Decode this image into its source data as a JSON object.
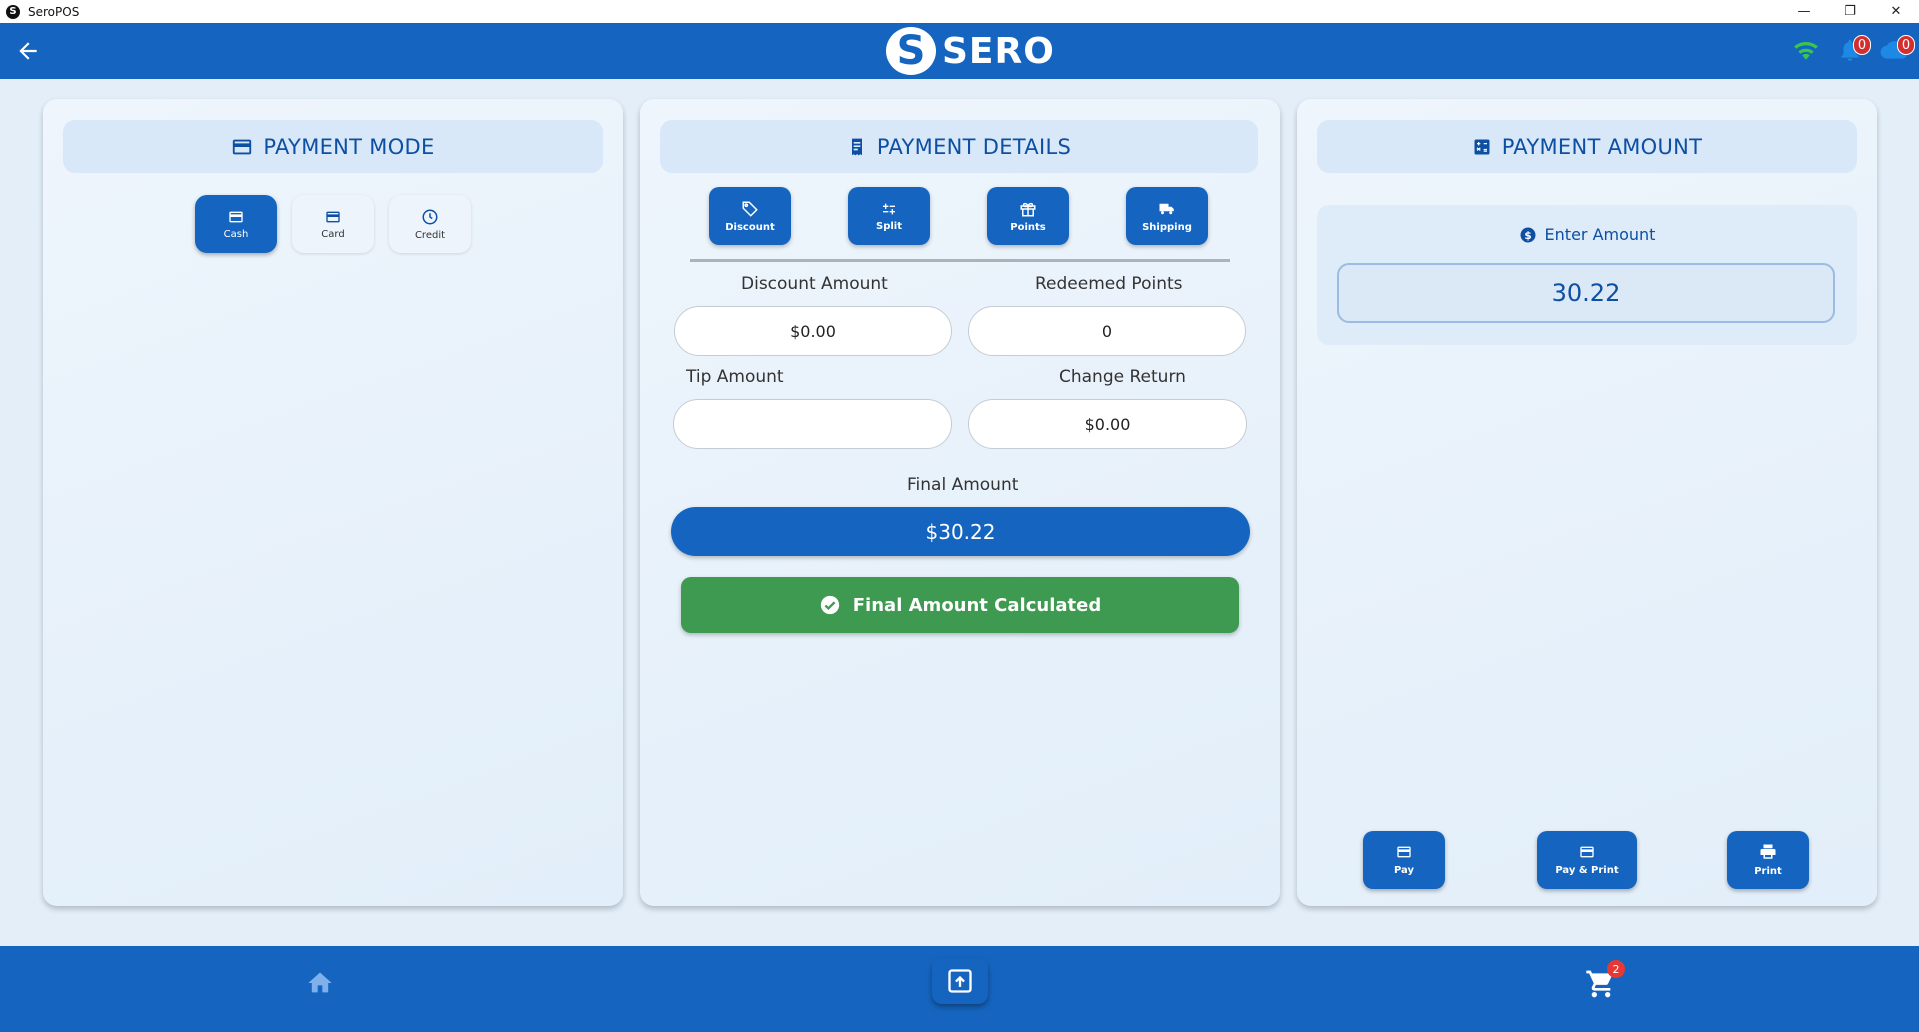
{
  "window": {
    "title": "SeroPOS",
    "minimize": "—",
    "restore": "❐",
    "close": "✕"
  },
  "header": {
    "logo_letter": "S",
    "logo_text": "SERO",
    "notifications_count": "0",
    "cloud_count": "0"
  },
  "payment_mode": {
    "title": "PAYMENT MODE",
    "modes": [
      {
        "label": "Cash",
        "active": true
      },
      {
        "label": "Card",
        "active": false
      },
      {
        "label": "Credit",
        "active": false
      }
    ]
  },
  "payment_details": {
    "title": "PAYMENT DETAILS",
    "tabs": [
      "Discount",
      "Split",
      "Points",
      "Shipping"
    ],
    "discount_amount_label": "Discount Amount",
    "discount_amount_value": "$0.00",
    "redeemed_points_label": "Redeemed Points",
    "redeemed_points_value": "0",
    "tip_amount_label": "Tip Amount",
    "tip_amount_value": "",
    "change_return_label": "Change Return",
    "change_return_value": "$0.00",
    "final_amount_label": "Final Amount",
    "final_amount_value": "$30.22",
    "calculated_label": "Final Amount Calculated"
  },
  "payment_amount": {
    "title": "PAYMENT AMOUNT",
    "enter_amount_label": "Enter Amount",
    "amount_value": "30.22",
    "actions": {
      "pay": "Pay",
      "pay_print": "Pay & Print",
      "print": "Print"
    }
  },
  "bottom_nav": {
    "cart_count": "2"
  },
  "colors": {
    "primary": "#1565c0",
    "success": "#3d9a50",
    "badge": "#d32f2f"
  }
}
